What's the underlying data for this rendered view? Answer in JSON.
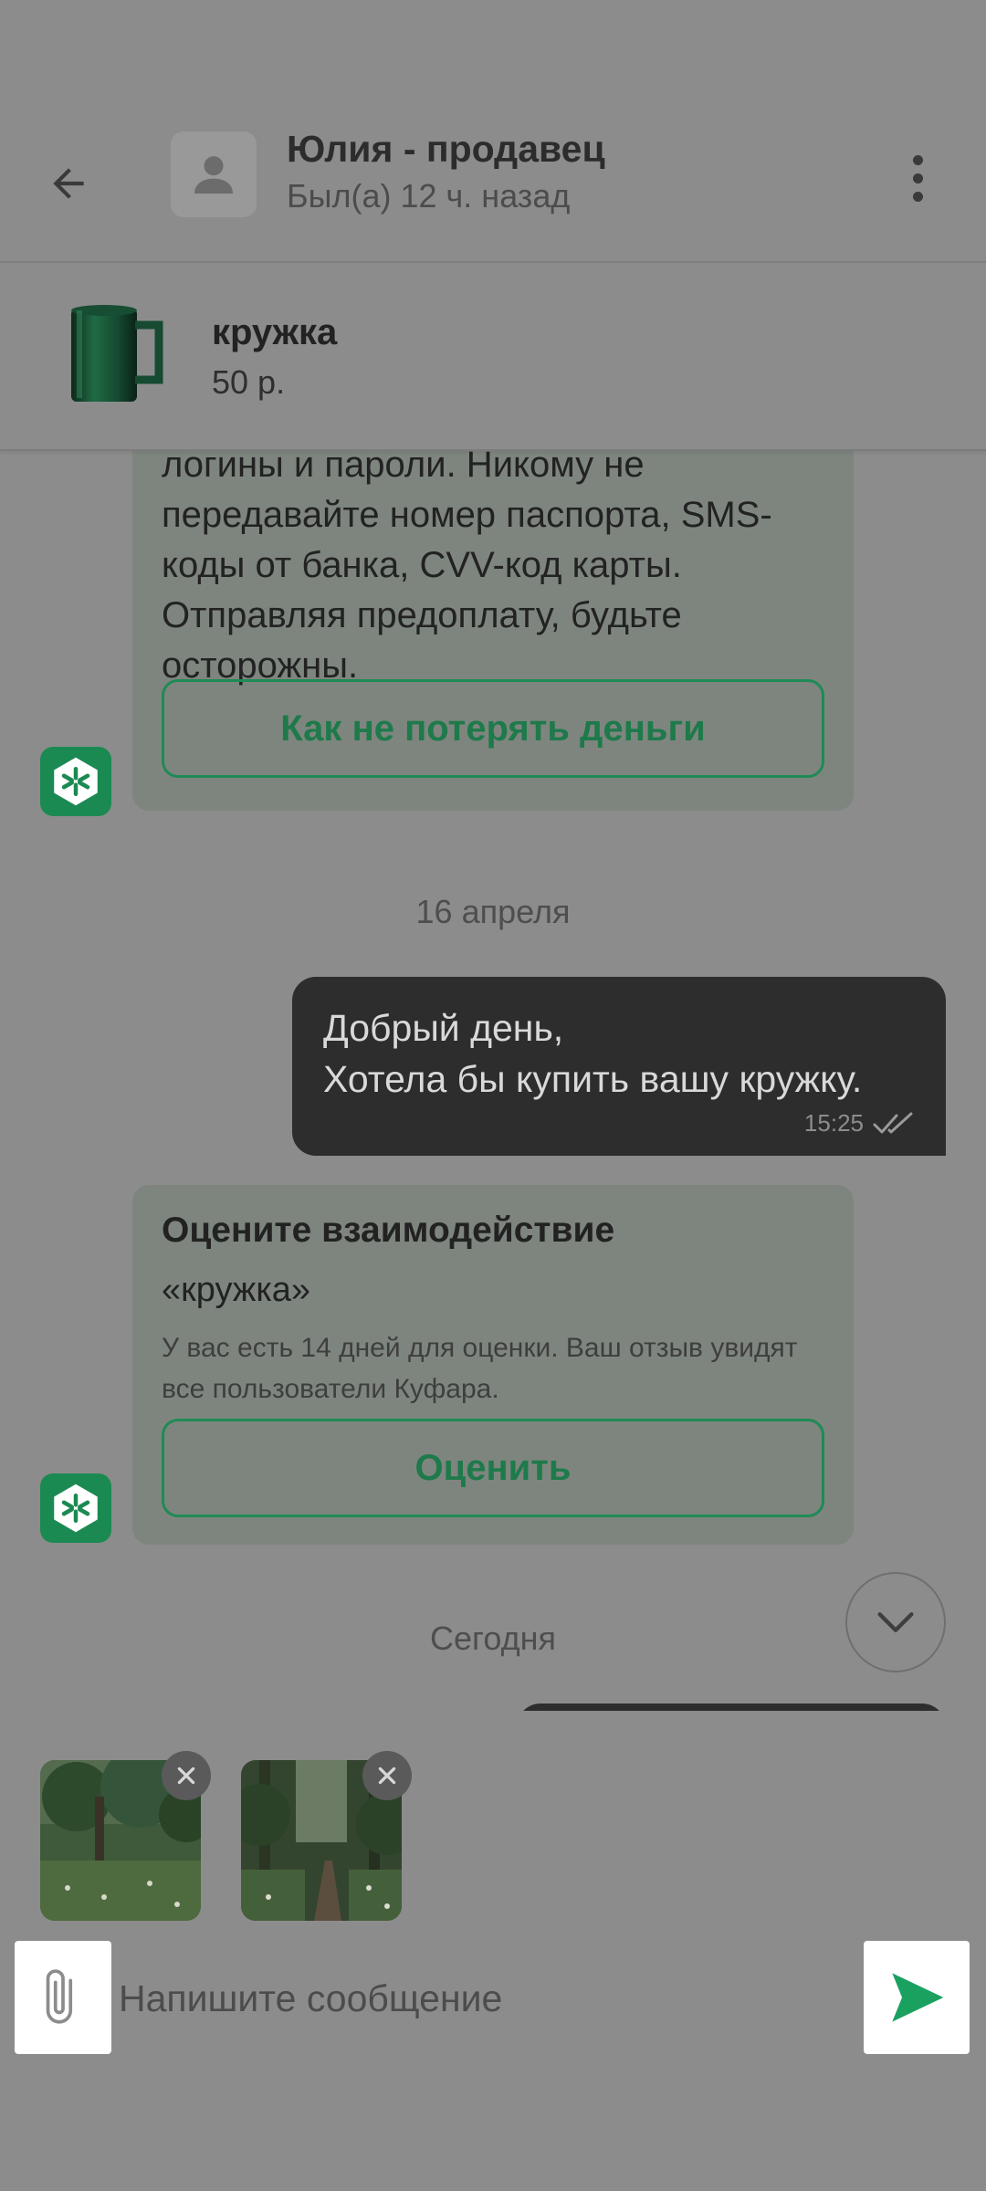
{
  "header": {
    "back_icon": "arrow-left-icon",
    "contact_name": "Юлия - продавец",
    "contact_status": "Был(а) 12 ч. назад",
    "menu_icon": "more-vertical-icon"
  },
  "product": {
    "name": "кружка",
    "price": "50 р."
  },
  "messages": {
    "safety_text": "логины и пароли. Никому не передавайте номер паспорта, SMS-коды от банка, CVV-код карты. Отправляя предоплату, будьте осторожны.",
    "safety_button": "Как не потерять деньги",
    "date_1": "16 апреля",
    "outgoing_text": "Добрый день,\nХотела бы купить вашу кружку.",
    "outgoing_time": "15:25",
    "rate_title": "Оцените взаимодействие",
    "rate_item": "«кружка»",
    "rate_desc": "У вас есть 14 дней для оценки. Ваш отзыв увидят все пользователи Куфара.",
    "rate_button": "Оценить",
    "date_2": "Сегодня"
  },
  "composer": {
    "placeholder": "Напишите сообщение",
    "attach_icon": "paperclip-icon",
    "send_icon": "send-icon",
    "attachments_count": 2
  },
  "colors": {
    "accent": "#1e8b55",
    "overlay": "#8c8c8c"
  }
}
